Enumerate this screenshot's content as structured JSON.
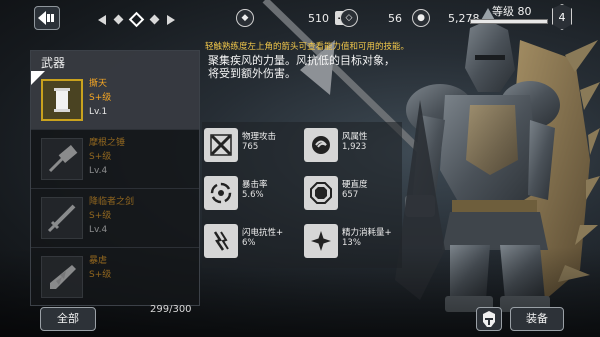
{
  "topbar": {
    "pager_pages": 3,
    "pager_active": 2,
    "currency1": {
      "icon": "gem-icon",
      "value": "510"
    },
    "currency2": {
      "icon": "crystal-icon",
      "value": "56"
    },
    "currency3": {
      "icon": "coin-icon",
      "value": "5,278"
    },
    "level_label": "等级 80",
    "level_progress": 1.0,
    "rank_badge": "4"
  },
  "hint": "轻触熟练度左上角的箭头可查看能力值和可用的技能。",
  "panel": {
    "title": "武器",
    "weapons": [
      {
        "name": "撕天",
        "grade": "S+级",
        "level": "Lv.1",
        "icon": "scroll-icon",
        "selected": true
      },
      {
        "name": "摩根之锤",
        "grade": "S+级",
        "level": "Lv.4",
        "icon": "hammer-icon",
        "selected": false
      },
      {
        "name": "降临者之剑",
        "grade": "S+级",
        "level": "Lv.4",
        "icon": "sword-icon",
        "selected": false
      },
      {
        "name": "暴虐",
        "grade": "S+级",
        "level": "",
        "icon": "spiked-blade-icon",
        "selected": false
      }
    ]
  },
  "description": "聚集疾风的力量。风抗低的目标对象，将受到额外伤害。",
  "stats": [
    {
      "label": "物理攻击",
      "value": "765",
      "icon": "physical-attack-icon"
    },
    {
      "label": "风属性",
      "value": "1,923",
      "icon": "wind-element-icon"
    },
    {
      "label": "暴击率",
      "value": "5.6%",
      "icon": "critical-rate-icon"
    },
    {
      "label": "硬直度",
      "value": "657",
      "icon": "stagger-icon"
    },
    {
      "label": "闪电抗性+",
      "value": "6%",
      "icon": "lightning-resist-icon"
    },
    {
      "label": "精力消耗量+",
      "value": "13%",
      "icon": "stamina-cost-icon"
    }
  ],
  "bottom": {
    "all_button": "全部",
    "count": "299/300",
    "equip_button": "装备",
    "helmet_icon": "helmet-icon"
  },
  "colors": {
    "accent_gold": "#f5a623",
    "hint_yellow": "#f2c84b"
  }
}
